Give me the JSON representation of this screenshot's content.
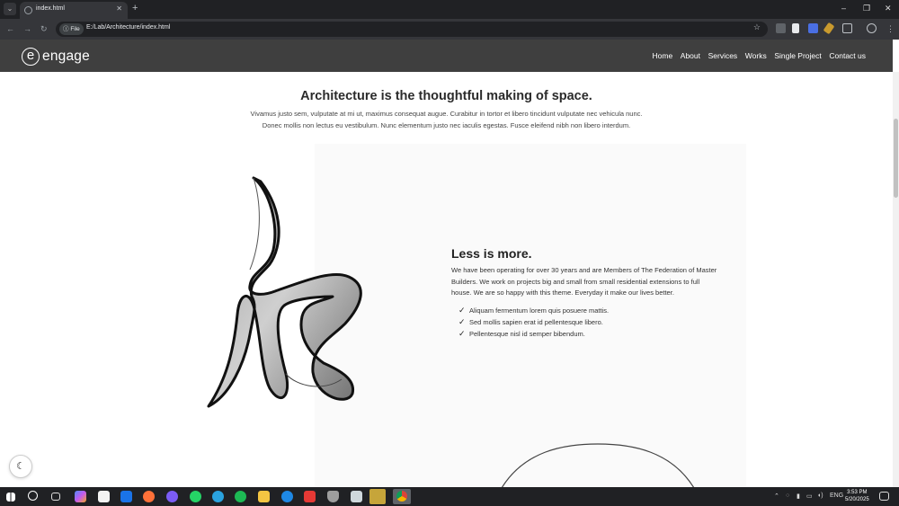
{
  "browser": {
    "tab_title": "index.html",
    "url_scheme": "File",
    "url": "E:/Lab/Architecture/index.html"
  },
  "site": {
    "logo_letter": "e",
    "logo_text": "engage",
    "nav": [
      "Home",
      "About",
      "Services",
      "Works",
      "Single Project",
      "Contact us"
    ]
  },
  "hero": {
    "title": "Architecture is the thoughtful making of space.",
    "text_line1": "Vivamus justo sem, vulputate at mi ut, maximus consequat augue. Curabitur in tortor et libero tincidunt vulputate nec vehicula nunc.",
    "text_line2": "Donec mollis non lectus eu vestibulum. Nunc elementum justo nec iaculis egestas. Fusce eleifend nibh non libero interdum."
  },
  "feature": {
    "title": "Less is more.",
    "text_line1": "We have been operating for over 30 years and are Members of The Federation of Master",
    "text_line2": "Builders. We work on projects big and small from small residential extensions to full",
    "text_line3": "house. We are so happy with this theme. Everyday it make our lives better.",
    "bullets": [
      "Aliquam fermentum lorem quis posuere mattis.",
      "Sed mollis sapien erat id pellentesque libero.",
      "Pellentesque nisl id semper bibendum."
    ]
  },
  "taskbar": {
    "language": "ENG",
    "time": "3:53 PM",
    "date": "5/20/2025"
  },
  "colors": {
    "header_bg": "#3f3f3f",
    "browser_dark": "#202124",
    "toolbar": "#35363a"
  }
}
